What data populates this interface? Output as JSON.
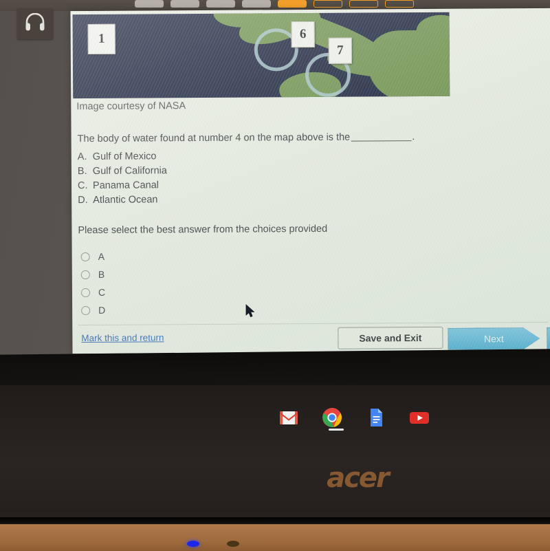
{
  "device": {
    "brand_logo": "acer",
    "headphone_icon": "headphones-icon",
    "leds": [
      "power-led-blue",
      "status-led-amber"
    ]
  },
  "shelf": {
    "items": [
      {
        "name": "gmail",
        "label": "Gmail"
      },
      {
        "name": "chrome",
        "label": "Google Chrome"
      },
      {
        "name": "docs",
        "label": "Google Docs"
      },
      {
        "name": "youtube",
        "label": "YouTube"
      }
    ]
  },
  "browser": {
    "tabs": [
      {
        "name": "tab-1",
        "state": "inactive",
        "color": "#b9b4ad"
      },
      {
        "name": "tab-2",
        "state": "inactive",
        "color": "#b9b4ad"
      },
      {
        "name": "tab-3",
        "state": "inactive",
        "color": "#b9b4ad"
      },
      {
        "name": "tab-4",
        "state": "inactive",
        "color": "#b9b4ad"
      },
      {
        "name": "tab-5",
        "state": "active",
        "color": "#f0a02a"
      },
      {
        "name": "tab-6",
        "state": "outline",
        "color": "#f0a02a"
      },
      {
        "name": "tab-7",
        "state": "outline",
        "color": "#f0a02a"
      },
      {
        "name": "tab-8",
        "state": "outline",
        "color": "#f0a02a"
      }
    ]
  },
  "quiz": {
    "figure": {
      "caption": "Image courtesy of NASA",
      "map_labels": [
        {
          "id": "label-1",
          "text": "1"
        },
        {
          "id": "label-6",
          "text": "6"
        },
        {
          "id": "label-7",
          "text": "7"
        }
      ],
      "annotation_shape": "circle"
    },
    "question": {
      "prefix": "The body of water found at number 4 on the map above is the",
      "suffix": ".",
      "blank": "__________"
    },
    "choices": [
      {
        "letter": "A.",
        "text": "Gulf of Mexico"
      },
      {
        "letter": "B.",
        "text": "Gulf of California"
      },
      {
        "letter": "C.",
        "text": "Panama Canal"
      },
      {
        "letter": "D.",
        "text": "Atlantic Ocean"
      }
    ],
    "instruction": "Please select the best answer from the choices provided",
    "answer_options": [
      {
        "value": "A",
        "selected": false
      },
      {
        "value": "B",
        "selected": false
      },
      {
        "value": "C",
        "selected": false
      },
      {
        "value": "D",
        "selected": false
      }
    ],
    "footer": {
      "mark_link": "Mark this and return",
      "save_button": "Save and Exit",
      "next_button": "Next"
    },
    "colors": {
      "page_background": "#e9ece2",
      "link": "#2b62b5",
      "next_button": "#42a7d0",
      "text": "#36373a"
    }
  }
}
